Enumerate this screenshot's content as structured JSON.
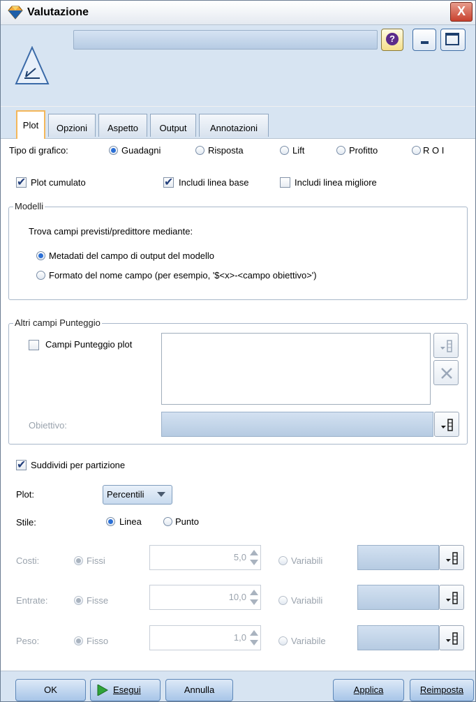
{
  "window": {
    "title": "Valutazione",
    "close_label": "X"
  },
  "header": {
    "node_name": "",
    "help_label": "?"
  },
  "tabs": [
    "Plot",
    "Opzioni",
    "Aspetto",
    "Output",
    "Annotazioni"
  ],
  "chart_type": {
    "label": "Tipo di grafico:",
    "options": [
      "Guadagni",
      "Risposta",
      "Lift",
      "Profitto",
      "R O I"
    ],
    "selected": "Guadagni"
  },
  "checks": {
    "cumulative": "Plot cumulato",
    "baseline": "Includi linea base",
    "best": "Includi linea migliore"
  },
  "models": {
    "title": "Modelli",
    "prompt": "Trova campi previsti/predittore mediante:",
    "option1": "Metadati del campo di output del modello",
    "option2": "Formato del nome campo (per esempio, '$<x>-<campo obiettivo>')"
  },
  "scores": {
    "title": "Altri campi Punteggio",
    "checkbox": "Campi Punteggio plot",
    "target_label": "Obiettivo:",
    "target_value": ""
  },
  "partition": {
    "label": "Suddividi per partizione"
  },
  "plot": {
    "label": "Plot:",
    "value": "Percentili"
  },
  "style": {
    "label": "Stile:",
    "line": "Linea",
    "point": "Punto"
  },
  "costs": {
    "label": "Costi:",
    "fixed": "Fissi",
    "value": "5,0",
    "variable": "Variabili"
  },
  "revenue": {
    "label": "Entrate:",
    "fixed": "Fisse",
    "value": "10,0",
    "variable": "Variabili"
  },
  "weight": {
    "label": "Peso:",
    "fixed": "Fisso",
    "value": "1,0",
    "variable": "Variabile"
  },
  "footer": {
    "ok": "OK",
    "run": "Esegui",
    "cancel": "Annulla",
    "apply": "Applica",
    "reset": "Reimposta"
  },
  "colors": {
    "active_tab_border": "#f4b75a",
    "header_bg": "#d7e4f2",
    "accent": "#2a6fd6"
  }
}
